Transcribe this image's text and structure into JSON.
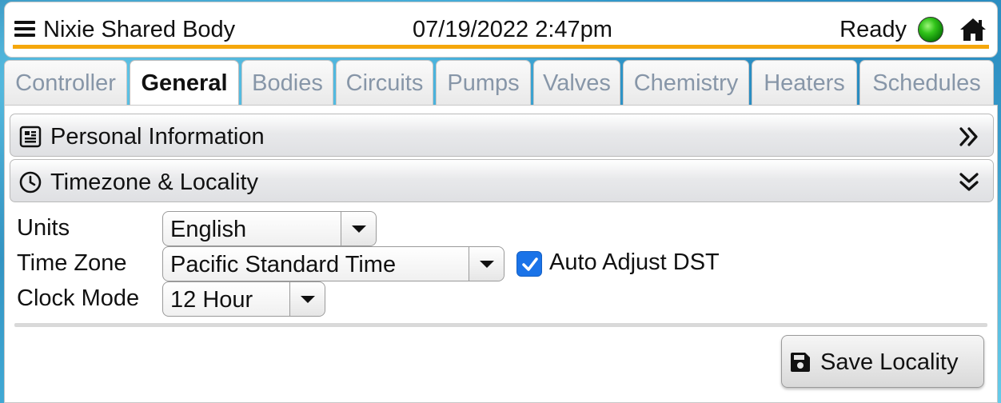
{
  "header": {
    "title": "Nixie Shared Body",
    "datetime": "07/19/2022 2:47pm",
    "status": "Ready",
    "accent_color": "#f5a70c",
    "status_color": "#31c41a"
  },
  "tabs": [
    {
      "label": "Controller",
      "active": false
    },
    {
      "label": "General",
      "active": true
    },
    {
      "label": "Bodies",
      "active": false
    },
    {
      "label": "Circuits",
      "active": false
    },
    {
      "label": "Pumps",
      "active": false
    },
    {
      "label": "Valves",
      "active": false
    },
    {
      "label": "Chemistry",
      "active": false
    },
    {
      "label": "Heaters",
      "active": false
    },
    {
      "label": "Schedules",
      "active": false
    }
  ],
  "sections": {
    "personal": {
      "title": "Personal Information",
      "icon": "address-card-icon",
      "expanded": false
    },
    "timezone": {
      "title": "Timezone & Locality",
      "icon": "clock-icon",
      "expanded": true
    }
  },
  "form": {
    "units": {
      "label": "Units",
      "value": "English"
    },
    "time_zone": {
      "label": "Time Zone",
      "value": "Pacific Standard Time"
    },
    "auto_dst": {
      "label": "Auto Adjust DST",
      "checked": true
    },
    "clock_mode": {
      "label": "Clock Mode",
      "value": "12 Hour"
    }
  },
  "actions": {
    "save_label": "Save Locality"
  }
}
